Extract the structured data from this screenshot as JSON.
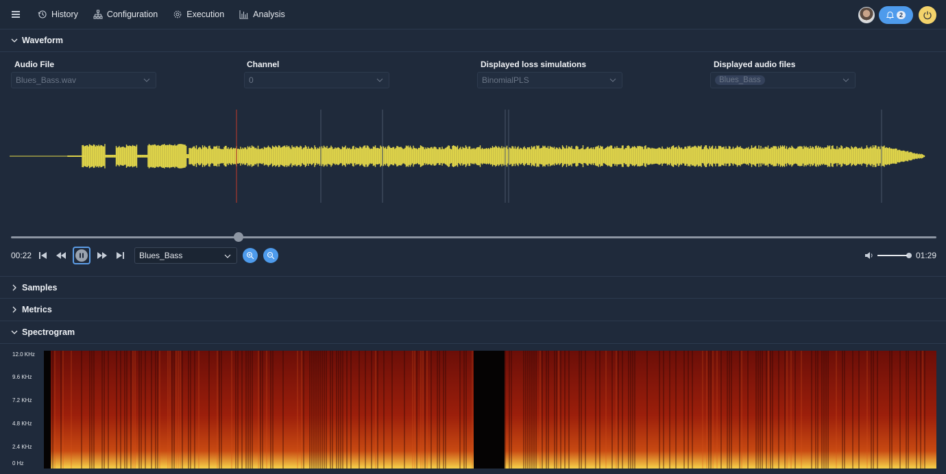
{
  "nav": {
    "items": [
      {
        "label": "History",
        "icon": "history-icon"
      },
      {
        "label": "Configuration",
        "icon": "sitemap-icon"
      },
      {
        "label": "Execution",
        "icon": "gear-icon"
      },
      {
        "label": "Analysis",
        "icon": "bar-chart-icon"
      }
    ],
    "notification_count": "2"
  },
  "waveform_section": {
    "title": "Waveform",
    "audio_file": {
      "label": "Audio File",
      "value": "Blues_Bass.wav"
    },
    "channel": {
      "label": "Channel",
      "value": "0"
    },
    "loss_sims": {
      "label": "Displayed loss simulations",
      "value": "BinomialPLS"
    },
    "audio_files": {
      "label": "Displayed audio files",
      "value": "Blues_Bass"
    }
  },
  "player": {
    "current_time": "00:22",
    "total_time": "01:29",
    "selected_file": "Blues_Bass",
    "progress_fraction": 0.247,
    "volume_fraction": 1.0
  },
  "collapsed_sections": {
    "samples": "Samples",
    "metrics": "Metrics"
  },
  "spectrogram": {
    "title": "Spectrogram",
    "ticks": [
      "12.0 KHz",
      "9.6 KHz",
      "7.2 KHz",
      "4.8 KHz",
      "2.4 KHz",
      "0   Hz"
    ]
  },
  "colors": {
    "background": "#1f2a3b",
    "waveform": "#e5d94a",
    "accent": "#4e9bec",
    "playhead": "#c0392b",
    "power": "#f3d36b"
  }
}
